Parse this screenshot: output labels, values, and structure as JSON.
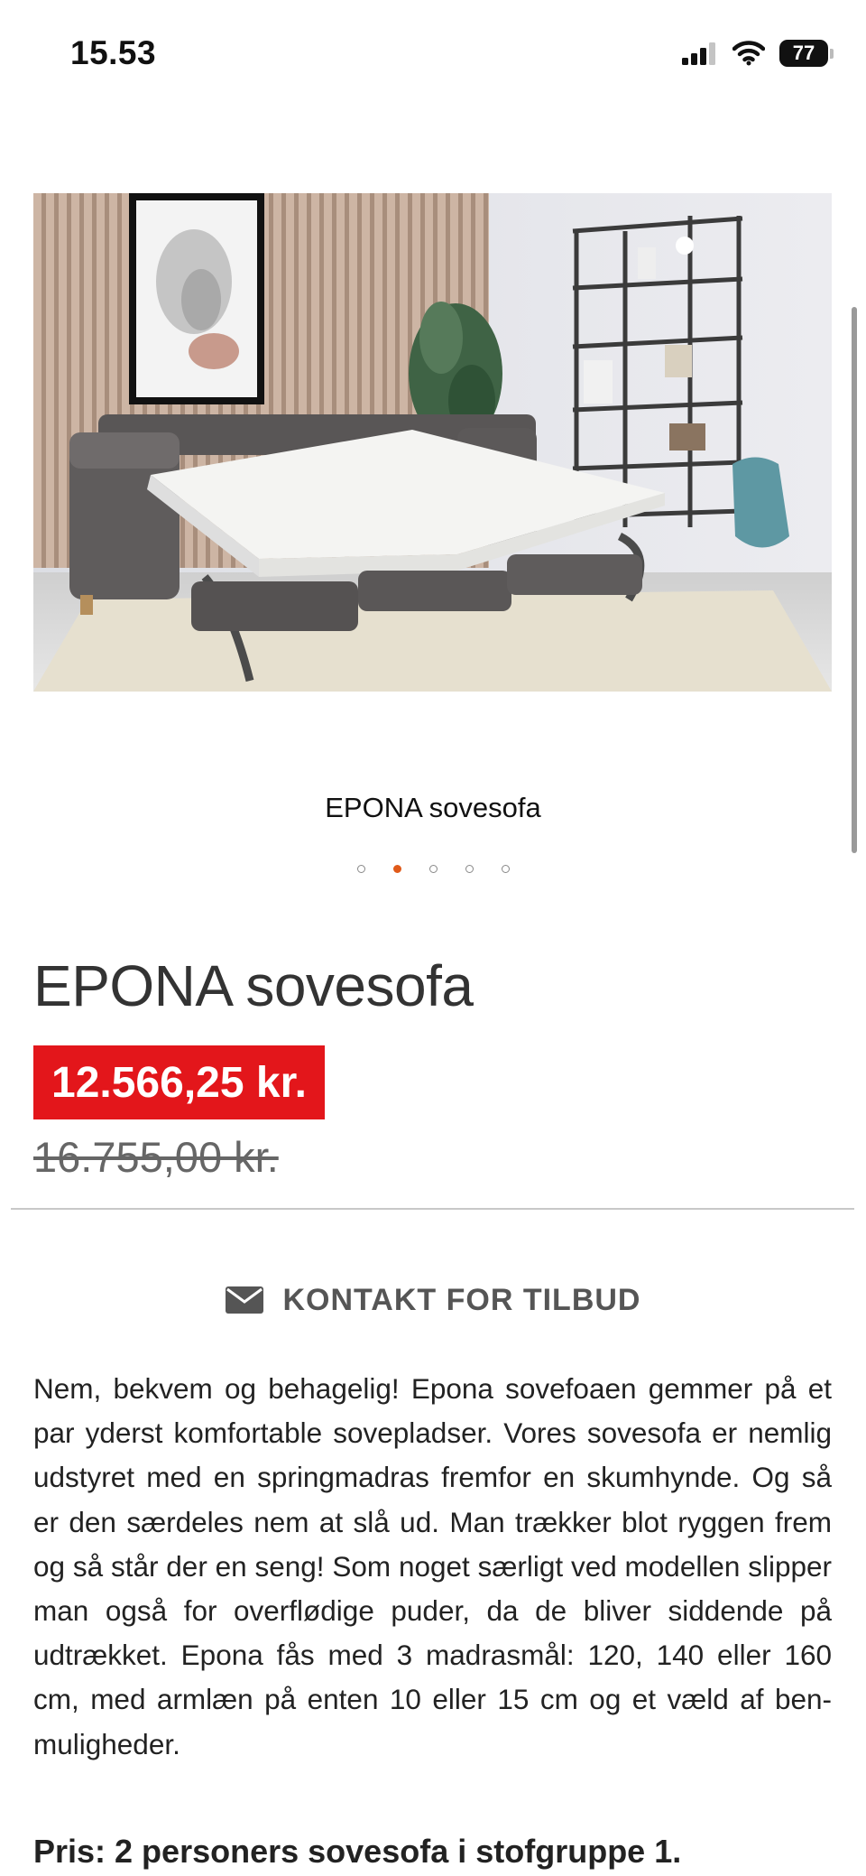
{
  "status_bar": {
    "time": "15.53",
    "battery_level": "77",
    "icons": [
      "signal-icon",
      "wifi-icon",
      "battery-icon"
    ]
  },
  "product": {
    "image_caption": "EPONA sovesofa",
    "carousel": {
      "count": 5,
      "active_index": 1,
      "active_color": "#e05a1a"
    },
    "title": "EPONA sovesofa",
    "price": "12.566,25 kr.",
    "old_price": "16.755,00 kr.",
    "price_badge_color": "#e3161b"
  },
  "contact": {
    "label": "KONTAKT FOR TILBUD",
    "icon": "mail-icon"
  },
  "description": "Nem, bekvem og behagelig! Epona sovefoaen gemmer på et par yderst komfortable sovepladser. Vores sovesofa er nemlig udstyret med en springmadras fremfor en skumhynde. Og så er den særdeles nem at slå ud. Man trækker blot ryggen frem og så står der en seng! Som noget særligt ved modellen slipper man også for overflødige puder, da de bliver siddende på udtrækket. Epona fås med 3 madrasmål: 120, 140 eller 160 cm, med armlæn på enten 10 eller 15 cm og et væld af ben-muligheder.",
  "price_heading": "Pris: 2 personers sovesofa i stofgruppe 1."
}
